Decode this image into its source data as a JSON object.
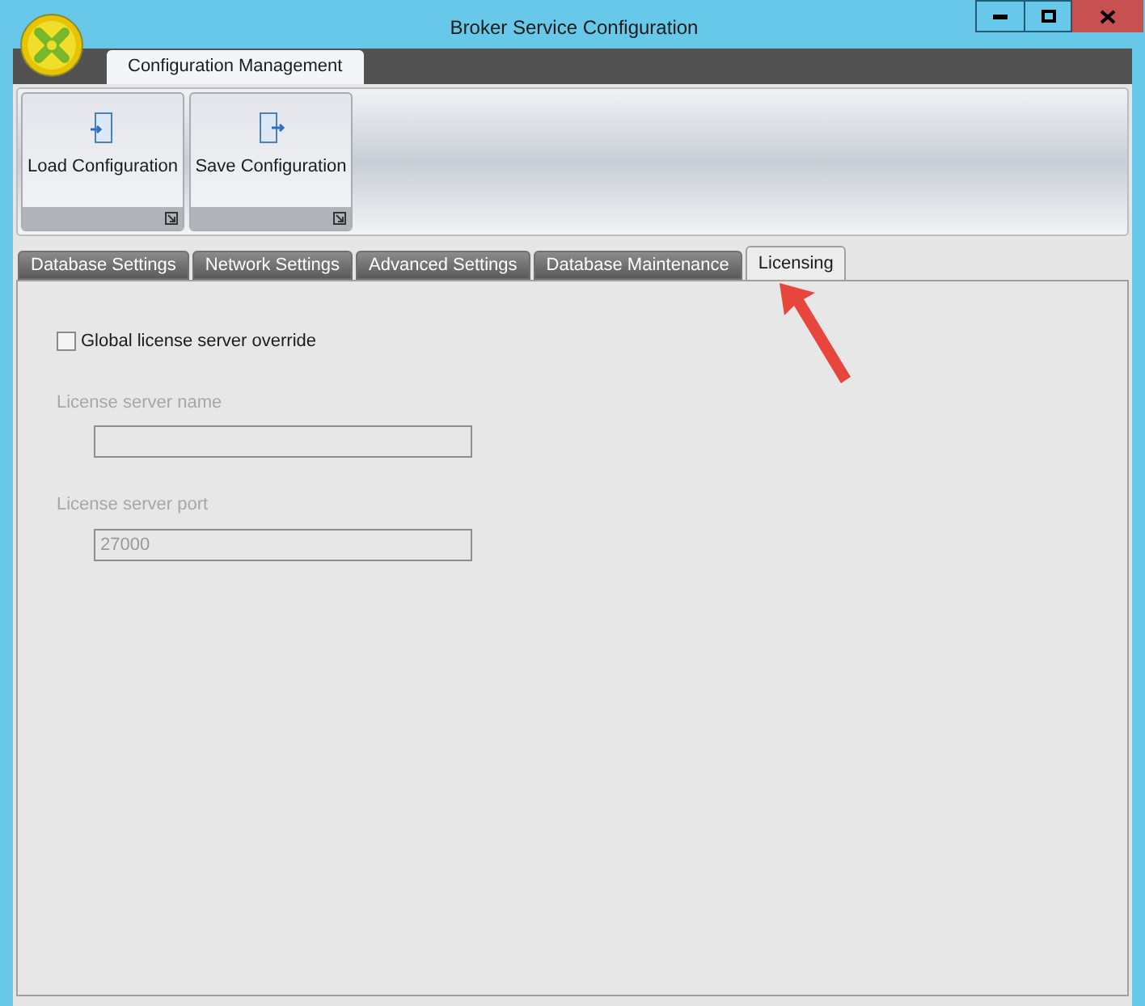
{
  "window": {
    "title": "Broker Service Configuration"
  },
  "ribbon": {
    "tab": {
      "label": "Configuration Management",
      "selected": true
    },
    "buttons": [
      {
        "label": "Load Configuration",
        "kind": "load"
      },
      {
        "label": "Save Configuration",
        "kind": "save"
      }
    ]
  },
  "tabs": [
    {
      "label": "Database Settings",
      "selected": false
    },
    {
      "label": "Network Settings",
      "selected": false
    },
    {
      "label": "Advanced Settings",
      "selected": false
    },
    {
      "label": "Database Maintenance",
      "selected": false
    },
    {
      "label": "Licensing",
      "selected": true
    }
  ],
  "licensing": {
    "override": {
      "label": "Global license server override",
      "checked": false
    },
    "fields": [
      {
        "label": "License server name",
        "disabled": true
      },
      {
        "label": "License server port",
        "value": "27000",
        "disabled": true
      }
    ]
  }
}
